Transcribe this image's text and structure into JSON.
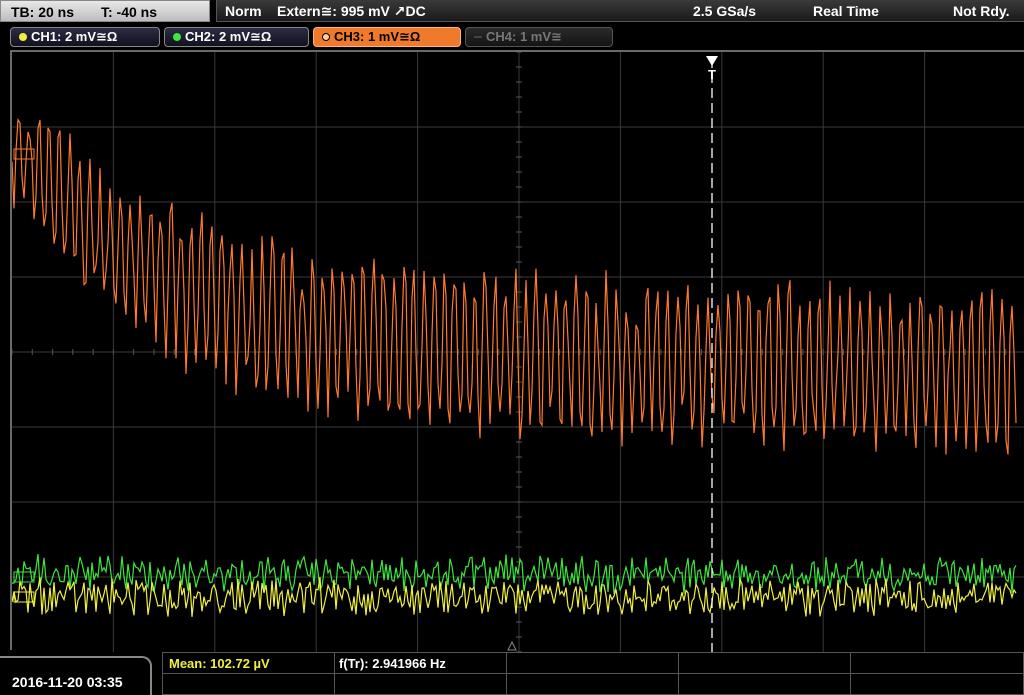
{
  "timebase": {
    "tb_label": "TB: 20 ns",
    "trigger_time_label": "T: -40 ns"
  },
  "status": {
    "mode": "Norm",
    "trigger_source": "Extern≅: 995 mV ↗DC",
    "sample_rate": "2.5 GSa/s",
    "acquisition": "Real Time",
    "ready_state": "Not Rdy."
  },
  "channels": [
    {
      "label": "CH1: 2 mV≅Ω",
      "color": "#f0f040"
    },
    {
      "label": "CH2: 2 mV≅Ω",
      "color": "#3ce63c"
    },
    {
      "label": "CH3: 1 mV≅Ω",
      "color": "#ff7a2a"
    },
    {
      "label": "CH4: 1 mV≅",
      "color": "#777777"
    }
  ],
  "trigger_marker": "T",
  "footer": {
    "datetime": "2016-11-20 03:35",
    "mean_measurement": "Mean: 102.72 µV",
    "frequency_measurement": "f(Tr): 2.941966 Hz"
  },
  "colors": {
    "grid": "#3a3a3a",
    "ch1": "#f0f040",
    "ch2": "#3ce63c",
    "ch3": "#ff7a2a"
  }
}
